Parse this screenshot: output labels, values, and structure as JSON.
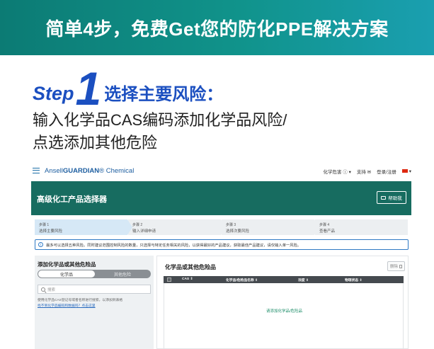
{
  "banner": {
    "title": "简单4步，免费Get您的防化PPE解决方案"
  },
  "step_heading": {
    "word": "Step",
    "number": "1",
    "title": "选择主要风险："
  },
  "description": {
    "line1": "输入化学品CAS编码添加化学品风险/",
    "line2": "点选添加其他危险"
  },
  "app": {
    "brand": {
      "prefix": "Ansell",
      "name": "GUARDIAN",
      "mark": "®",
      "suffix": "Chemical"
    },
    "nav": {
      "language": "化学危害 ⓘ ▾",
      "support": "支持 ✉",
      "login": "登录/注册",
      "flag_arrow": "▾"
    },
    "header": {
      "title": "高级化工产品选择器",
      "help_label": "帮助我"
    },
    "steps": [
      {
        "num": "步骤 1",
        "label": "选择主要风险"
      },
      {
        "num": "步骤 2",
        "label": "输入详细申请"
      },
      {
        "num": "步骤 3",
        "label": "选择次要风险"
      },
      {
        "num": "步骤 4",
        "label": "查看产品"
      }
    ],
    "info_text": "最多可以选择五种风险。同时建议范围控制风险的数量，只选择与特定任务相关的风险，以获得最好的产品建议，获取最佳产品建议，请仅输入单一风险。",
    "left_panel": {
      "title": "添加化学品或其他危险品",
      "toggle_active": "化学品",
      "toggle_inactive": "其他危险",
      "search_placeholder": "搜索",
      "hint": "使用化学品CAS登记号或者名称进行搜索，以添加到表格",
      "hint_link": "找不到化学品编码和数据吗？点击这里"
    },
    "right_panel": {
      "title": "化学品或其他危险品",
      "delete_label": "删除",
      "columns": [
        "CAS ⇕",
        "化学品/危险品名称 ⇕",
        "浓度 ⇕",
        "物理状态 ⇕"
      ],
      "empty_message": "请添加化学品/危险品"
    }
  }
}
